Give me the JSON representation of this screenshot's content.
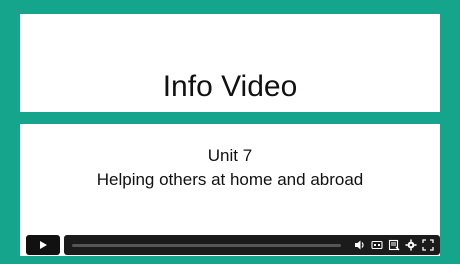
{
  "video": {
    "title": "Info Video",
    "unit": "Unit 7",
    "subtitle": "Helping others at home and abroad"
  },
  "player": {
    "progress": 0.0,
    "icons": [
      "play-icon",
      "volume-icon",
      "captions-icon",
      "transcript-icon",
      "settings-icon",
      "fullscreen-icon"
    ]
  },
  "colors": {
    "frame": "#14a58c",
    "panel": "#ffffff",
    "player": "#1b1b1b"
  }
}
